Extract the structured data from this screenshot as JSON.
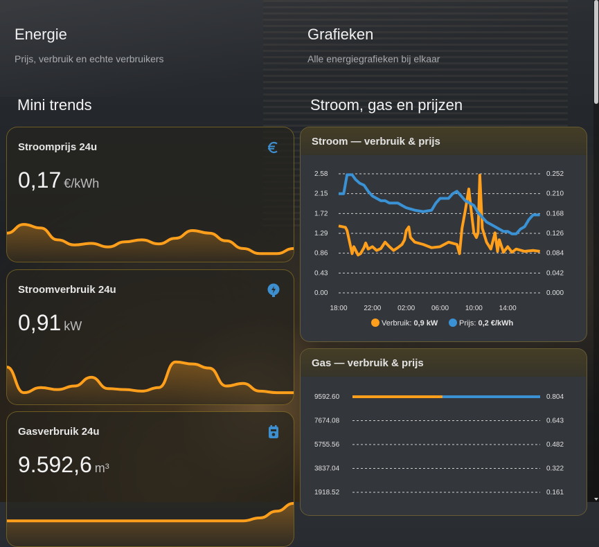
{
  "header": {
    "left": {
      "title": "Energie",
      "subtitle": "Prijs, verbruik en echte verbruikers"
    },
    "right": {
      "title": "Grafieken",
      "subtitle": "Alle energiegrafieken bij elkaar"
    }
  },
  "sections": {
    "mini_trends": "Mini trends",
    "stroom_gas": "Stroom, gas en prijzen"
  },
  "cards": [
    {
      "title": "Stroomprijs 24u",
      "value": "0,17",
      "unit": "€/kWh",
      "icon": "euro-icon",
      "trend": [
        0.45,
        0.62,
        0.55,
        0.32,
        0.22,
        0.25,
        0.18,
        0.28,
        0.32,
        0.24,
        0.35,
        0.5,
        0.45,
        0.3,
        0.15,
        0.05,
        0.05,
        0.15
      ]
    },
    {
      "title": "Stroomverbruik 24u",
      "value": "0,91",
      "unit": "kW",
      "icon": "plug-icon",
      "trend": [
        0.62,
        0.12,
        0.22,
        0.18,
        0.25,
        0.42,
        0.2,
        0.18,
        0.15,
        0.22,
        0.72,
        0.68,
        0.6,
        0.25,
        0.3,
        0.15,
        0.12,
        0.12
      ]
    },
    {
      "title": "Gasverbruik 24u",
      "value": "9.592,6",
      "unit": "m³",
      "icon": "gas-meter-icon",
      "trend": [
        0.02,
        0.02,
        0.02,
        0.02,
        0.02,
        0.02,
        0.02,
        0.02,
        0.02,
        0.02,
        0.02,
        0.02,
        0.02,
        0.02,
        0.02,
        0.05,
        0.12,
        0.2
      ]
    }
  ],
  "graphs": {
    "stroom": {
      "title": "Stroom — verbruik & prijs"
    },
    "gas": {
      "title": "Gas — verbruik & prijs"
    }
  },
  "colors": {
    "orange": "#ff9f1c",
    "blue": "#3a92d4",
    "accent_border": "#c8a028"
  },
  "chart_data": [
    {
      "type": "line",
      "title": "Stroom — verbruik & prijs",
      "x_ticks": [
        "18:00",
        "22:00",
        "02:00",
        "06:00",
        "10:00",
        "14:00"
      ],
      "y_left_ticks": [
        "2.58",
        "2.15",
        "1.72",
        "1.29",
        "0.86",
        "0.43",
        "0.00"
      ],
      "y_right_ticks": [
        "0.252",
        "0.210",
        "0.168",
        "0.126",
        "0.084",
        "0.042",
        "0.000"
      ],
      "ylim_left": [
        0,
        2.58
      ],
      "ylim_right": [
        0,
        0.252
      ],
      "xlim": [
        0,
        24
      ],
      "series": [
        {
          "name": "Verbruik",
          "legend_value": "0,9 kW",
          "color": "#ff9f1c",
          "axis": "left",
          "x": [
            0,
            0.8,
            1.0,
            1.6,
            1.8,
            2.3,
            2.6,
            3.0,
            3.2,
            3.5,
            4.0,
            4.5,
            5.0,
            5.5,
            6.0,
            6.5,
            7.0,
            7.5,
            7.8,
            8.0,
            8.3,
            8.5,
            9.0,
            10.0,
            11.0,
            12.0,
            13.0,
            14.0,
            14.3,
            14.6,
            15.0,
            15.4,
            15.7,
            16.0,
            16.3,
            16.5,
            16.7,
            17.0,
            17.5,
            18.0,
            18.5,
            18.8,
            19.0,
            19.5,
            20.0,
            20.5,
            21.0,
            22.0,
            23.0,
            23.8
          ],
          "y": [
            1.45,
            1.42,
            1.35,
            0.85,
            1.0,
            0.82,
            0.85,
            0.98,
            1.08,
            0.95,
            1.0,
            0.92,
            0.96,
            1.1,
            1.0,
            0.92,
            0.98,
            1.05,
            1.15,
            1.35,
            1.43,
            1.2,
            1.1,
            1.05,
            0.98,
            1.0,
            1.1,
            1.05,
            0.85,
            1.4,
            1.8,
            2.25,
            1.75,
            1.3,
            1.2,
            1.3,
            2.55,
            1.4,
            1.1,
            0.95,
            1.3,
            0.9,
            1.15,
            0.88,
            1.0,
            0.88,
            0.95,
            0.9,
            0.92,
            0.9
          ]
        },
        {
          "name": "Prijs",
          "legend_value": "0,2 €/kWh",
          "color": "#3a92d4",
          "axis": "right",
          "x": [
            0,
            0.6,
            1.0,
            1.6,
            2.0,
            2.5,
            3.0,
            3.5,
            4.0,
            4.5,
            5.0,
            5.5,
            6.0,
            6.5,
            7.0,
            7.5,
            8.0,
            9.0,
            10.0,
            11.0,
            11.5,
            12.0,
            13.0,
            13.5,
            14.0,
            14.5,
            15.0,
            15.5,
            16.0,
            16.5,
            17.0,
            17.5,
            18.0,
            18.5,
            19.0,
            19.5,
            20.0,
            20.5,
            21.0,
            21.5,
            22.0,
            22.5,
            23.0,
            23.8
          ],
          "y": [
            0.21,
            0.21,
            0.25,
            0.25,
            0.24,
            0.232,
            0.228,
            0.215,
            0.205,
            0.2,
            0.195,
            0.195,
            0.19,
            0.19,
            0.19,
            0.185,
            0.18,
            0.175,
            0.172,
            0.175,
            0.19,
            0.2,
            0.2,
            0.21,
            0.215,
            0.205,
            0.195,
            0.19,
            0.185,
            0.17,
            0.16,
            0.15,
            0.145,
            0.14,
            0.135,
            0.13,
            0.13,
            0.125,
            0.125,
            0.135,
            0.14,
            0.155,
            0.165,
            0.165
          ]
        }
      ],
      "legend": "bottom-center",
      "grid": true
    },
    {
      "type": "line",
      "title": "Gas — verbruik & prijs",
      "y_left_ticks": [
        "9592.60",
        "7674.08",
        "5755.56",
        "3837.04",
        "1918.52"
      ],
      "y_right_ticks": [
        "0.804",
        "0.643",
        "0.482",
        "0.322",
        "0.161"
      ],
      "ylim_left": [
        0,
        9592.6
      ],
      "ylim_right": [
        0,
        0.804
      ],
      "xlim": [
        0,
        24
      ],
      "series": [
        {
          "name": "Verbruik",
          "color": "#ff9f1c",
          "axis": "left",
          "x": [
            0,
            24
          ],
          "y": [
            9592.6,
            9592.6
          ]
        },
        {
          "name": "Prijs",
          "color": "#3a92d4",
          "axis": "right",
          "x": [
            11.5,
            24
          ],
          "y": [
            0.804,
            0.804
          ]
        }
      ],
      "grid": true
    }
  ]
}
